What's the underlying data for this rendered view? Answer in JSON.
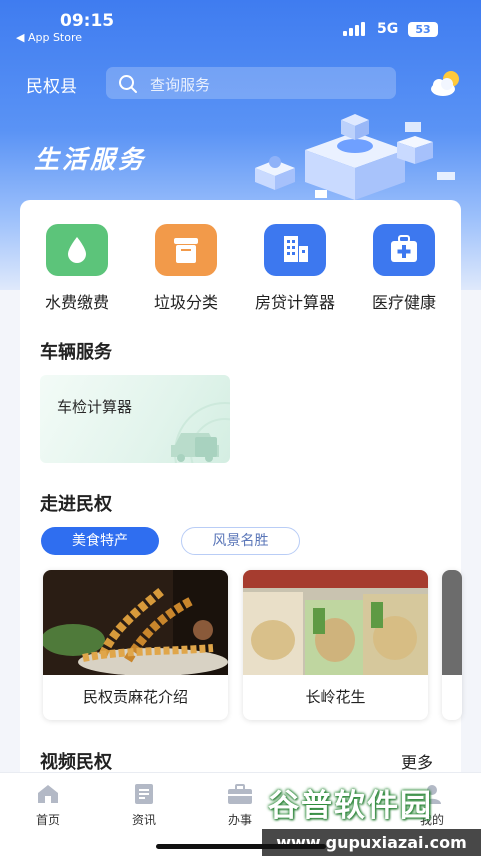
{
  "status_bar": {
    "time": "09:15",
    "back_app": "◀ App Store",
    "network": "5G",
    "battery": "53"
  },
  "header": {
    "county": "民权县",
    "search_placeholder": "查询服务",
    "weather_icon": "partly-cloudy-icon"
  },
  "hero": {
    "title": "生活服务"
  },
  "services": [
    {
      "label": "水费缴费",
      "icon": "water-drop-icon",
      "color": "#5cc47a"
    },
    {
      "label": "垃圾分类",
      "icon": "trash-bin-icon",
      "color": "#f29a4a"
    },
    {
      "label": "房贷计算器",
      "icon": "building-icon",
      "color": "#3d78ef"
    },
    {
      "label": "医疗健康",
      "icon": "medical-kit-icon",
      "color": "#3d78ef"
    }
  ],
  "vehicle": {
    "section_title": "车辆服务",
    "card_label": "车检计算器"
  },
  "intro": {
    "section_title": "走进民权",
    "tabs": [
      {
        "label": "美食特产",
        "active": true
      },
      {
        "label": "风景名胜",
        "active": false
      }
    ],
    "cards": [
      {
        "caption": "民权贡麻花介绍"
      },
      {
        "caption": "长岭花生"
      }
    ]
  },
  "video": {
    "section_title": "视频民权",
    "more": "更多"
  },
  "bottom_nav": [
    {
      "label": "首页",
      "icon": "home-icon"
    },
    {
      "label": "资讯",
      "icon": "news-icon"
    },
    {
      "label": "办事",
      "icon": "briefcase-icon"
    },
    {
      "label": "我的",
      "icon": "user-icon"
    }
  ],
  "watermark": {
    "title": "谷普软件园",
    "url": "www.gupuxiazai.com"
  },
  "colors": {
    "primary": "#2f6ef0",
    "hero_top": "#3f7cf0"
  }
}
